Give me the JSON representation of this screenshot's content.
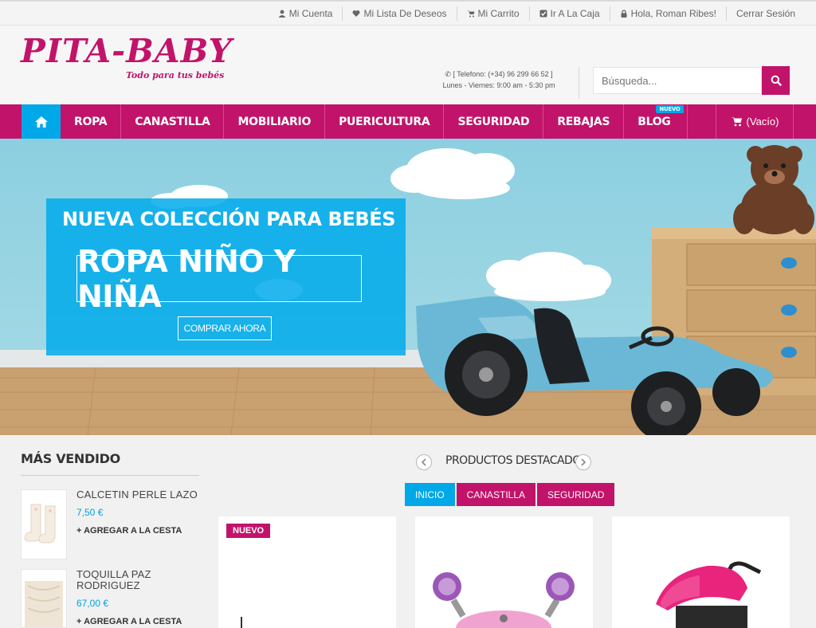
{
  "colors": {
    "brand_pink": "#c2136a",
    "accent_blue": "#00a8e8",
    "price_blue": "#00a2e0"
  },
  "topbar": {
    "links": [
      {
        "label": "Mi Cuenta",
        "icon": "user-icon"
      },
      {
        "label": "Mi Lista De Deseos",
        "icon": "heart-icon"
      },
      {
        "label": "Mi Carrito",
        "icon": "cart-icon"
      },
      {
        "label": "Ir A La Caja",
        "icon": "checkbox-icon"
      },
      {
        "label": "Hola, Roman Ribes!",
        "icon": "lock-icon"
      },
      {
        "label": "Cerrar Sesión",
        "icon": ""
      }
    ]
  },
  "header": {
    "logo_title": "PITA-BABY",
    "logo_tagline": "Todo para tus bebés",
    "phone": "[ Telefono: (+34) 96 299 66 52 ]",
    "hours": "Lunes - Viernes: 9:00 am - 5:30 pm",
    "search_placeholder": "Búsqueda..."
  },
  "nav": {
    "home_icon": "home-icon",
    "items": [
      "ROPA",
      "CANASTILLA",
      "MOBILIARIO",
      "PUERICULTURA",
      "SEGURIDAD",
      "REBAJAS",
      "BLOG"
    ],
    "blog_badge": "NUEVO",
    "cart_label": "(Vacío)"
  },
  "hero": {
    "heading": "NUEVA COLECCIÓN PARA BEBÉS",
    "subheading": "ROPA NIÑO Y NIÑA",
    "button": "COMPRAR AHORA"
  },
  "bestsellers": {
    "title": "MÁS VENDIDO",
    "items": [
      {
        "name": "CALCETIN PERLE LAZO",
        "price": "7,50 €",
        "add": "+ AGREGAR A LA CESTA"
      },
      {
        "name": "TOQUILLA PAZ RODRIGUEZ",
        "price": "67,00 €",
        "add": "+ AGREGAR A LA CESTA"
      }
    ]
  },
  "featured": {
    "title": "PRODUCTOS DESTACADOS",
    "tabs": [
      "INICIO",
      "CANASTILLA",
      "SEGURIDAD"
    ],
    "new_badge": "NUEVO"
  }
}
